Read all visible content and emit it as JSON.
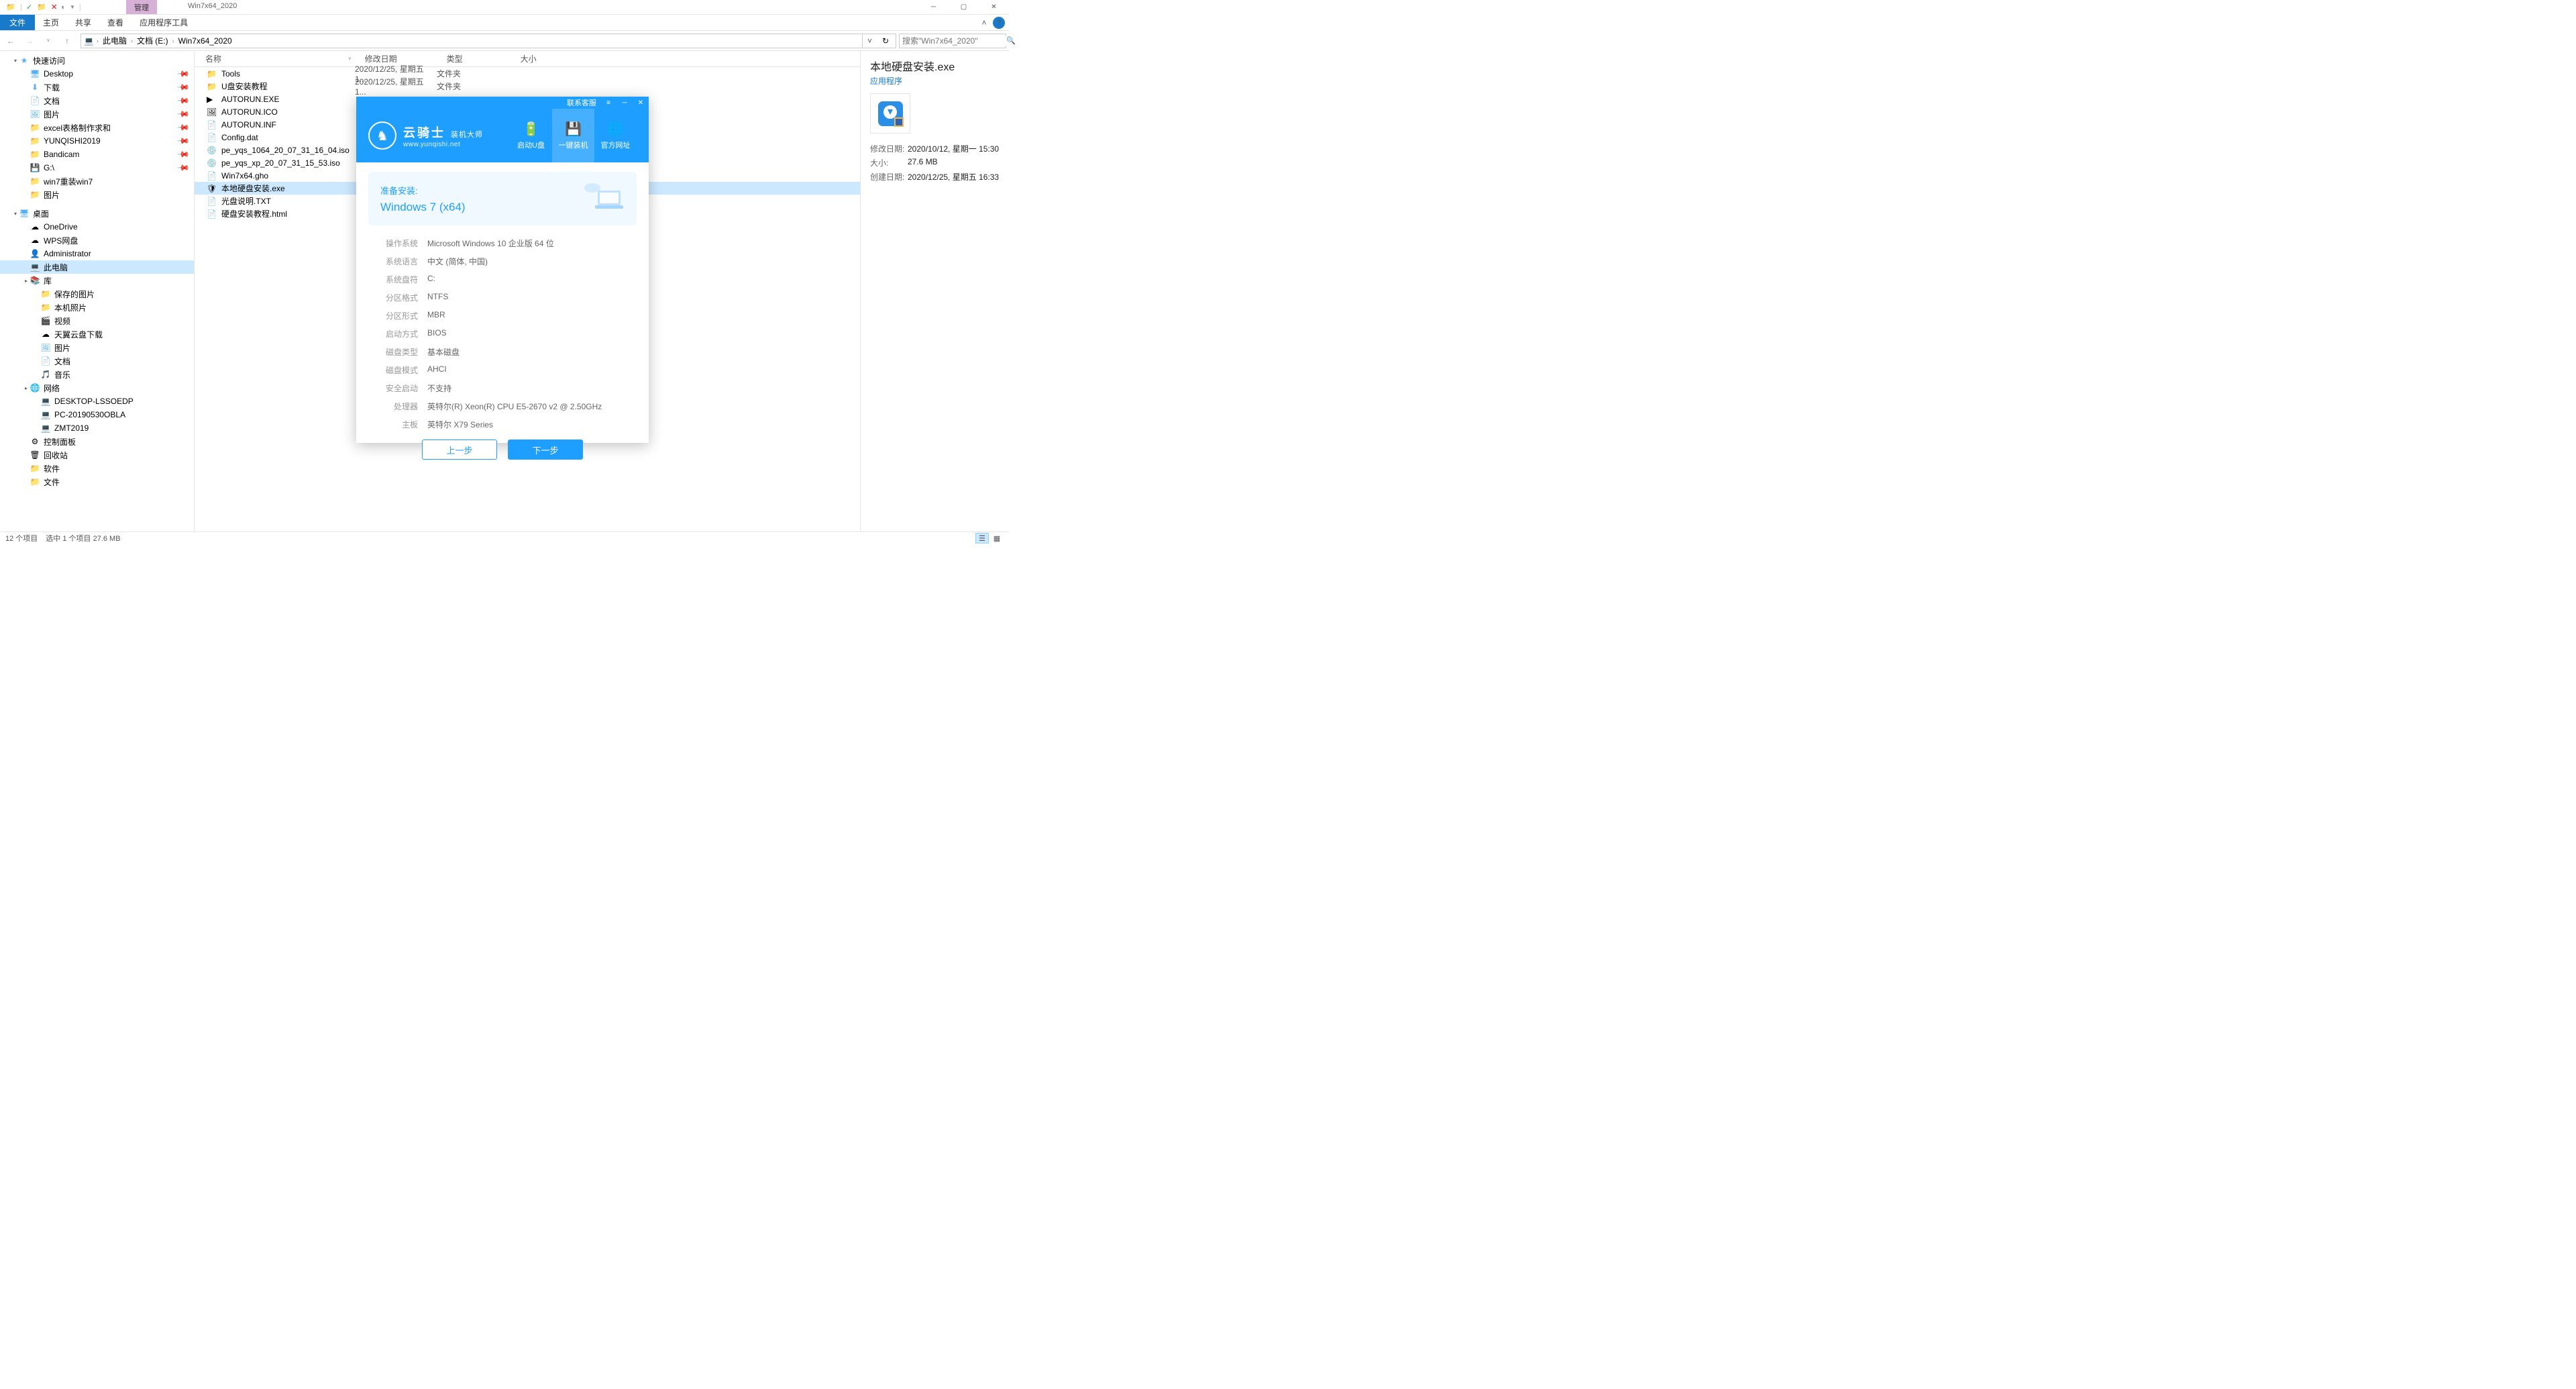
{
  "title_bar": {
    "context_tab": "管理",
    "window_title": "Win7x64_2020"
  },
  "ribbon": {
    "file": "文件",
    "home": "主页",
    "share": "共享",
    "view": "查看",
    "apptools": "应用程序工具"
  },
  "breadcrumb": {
    "root": "此电脑",
    "drive": "文档 (E:)",
    "folder": "Win7x64_2020"
  },
  "search": {
    "placeholder": "搜索\"Win7x64_2020\""
  },
  "sidebar_groups": [
    {
      "indent": 18,
      "icon": "star-icon",
      "glyph": "★",
      "label": "快速访问",
      "exp": "▾"
    },
    {
      "indent": 34,
      "icon": "desktop-icon",
      "glyph": "🖥",
      "label": "Desktop",
      "pin": true
    },
    {
      "indent": 34,
      "icon": "download-icon",
      "glyph": "⬇",
      "label": "下载",
      "pin": true
    },
    {
      "indent": 34,
      "icon": "doc-icon",
      "glyph": "📄",
      "label": "文档",
      "pin": true
    },
    {
      "indent": 34,
      "icon": "pic-icon",
      "glyph": "🖼",
      "label": "图片",
      "pin": true
    },
    {
      "indent": 34,
      "icon": "folder-icon",
      "glyph": "📁",
      "label": "excel表格制作求和",
      "pin": true
    },
    {
      "indent": 34,
      "icon": "folder-icon",
      "glyph": "📁",
      "label": "YUNQISHI2019",
      "pin": true
    },
    {
      "indent": 34,
      "icon": "folder-icon",
      "glyph": "📁",
      "label": "Bandicam",
      "pin": true
    },
    {
      "indent": 34,
      "icon": "drive-icon",
      "glyph": "💾",
      "label": "G:\\",
      "pin": true
    },
    {
      "indent": 34,
      "icon": "folder-icon",
      "glyph": "📁",
      "label": "win7重装win7"
    },
    {
      "indent": 34,
      "icon": "folder-icon",
      "glyph": "📁",
      "label": "图片"
    },
    {
      "sep": true
    },
    {
      "indent": 18,
      "icon": "desktop-icon",
      "glyph": "🖥",
      "label": "桌面",
      "exp": "▾"
    },
    {
      "indent": 34,
      "icon": "",
      "glyph": "☁",
      "label": "OneDrive"
    },
    {
      "indent": 34,
      "icon": "",
      "glyph": "☁",
      "label": "WPS网盘"
    },
    {
      "indent": 34,
      "icon": "",
      "glyph": "👤",
      "label": "Administrator"
    },
    {
      "indent": 34,
      "icon": "pc-icon",
      "glyph": "💻",
      "label": "此电脑",
      "selected": true
    },
    {
      "indent": 34,
      "icon": "",
      "glyph": "📚",
      "label": "库",
      "exp": "▸"
    },
    {
      "indent": 50,
      "icon": "folder-icon",
      "glyph": "📁",
      "label": "保存的图片"
    },
    {
      "indent": 50,
      "icon": "folder-icon",
      "glyph": "📁",
      "label": "本机照片"
    },
    {
      "indent": 50,
      "icon": "",
      "glyph": "🎬",
      "label": "视频"
    },
    {
      "indent": 50,
      "icon": "",
      "glyph": "☁",
      "label": "天翼云盘下载"
    },
    {
      "indent": 50,
      "icon": "pic-icon",
      "glyph": "🖼",
      "label": "图片"
    },
    {
      "indent": 50,
      "icon": "doc-icon",
      "glyph": "📄",
      "label": "文档"
    },
    {
      "indent": 50,
      "icon": "",
      "glyph": "🎵",
      "label": "音乐"
    },
    {
      "indent": 34,
      "icon": "",
      "glyph": "🌐",
      "label": "网络",
      "exp": "▸"
    },
    {
      "indent": 50,
      "icon": "pc-icon",
      "glyph": "💻",
      "label": "DESKTOP-LSSOEDP"
    },
    {
      "indent": 50,
      "icon": "pc-icon",
      "glyph": "💻",
      "label": "PC-20190530OBLA"
    },
    {
      "indent": 50,
      "icon": "pc-icon",
      "glyph": "💻",
      "label": "ZMT2019"
    },
    {
      "indent": 34,
      "icon": "",
      "glyph": "⚙",
      "label": "控制面板"
    },
    {
      "indent": 34,
      "icon": "",
      "glyph": "🗑",
      "label": "回收站"
    },
    {
      "indent": 34,
      "icon": "folder-icon",
      "glyph": "📁",
      "label": "软件"
    },
    {
      "indent": 34,
      "icon": "folder-icon",
      "glyph": "📁",
      "label": "文件"
    }
  ],
  "file_headers": {
    "name": "名称",
    "date": "修改日期",
    "type": "类型",
    "size": "大小"
  },
  "files": [
    {
      "glyph": "📁",
      "cls": "folder-icon",
      "name": "Tools",
      "date": "2020/12/25, 星期五 1...",
      "type": "文件夹"
    },
    {
      "glyph": "📁",
      "cls": "folder-icon",
      "name": "U盘安装教程",
      "date": "2020/12/25, 星期五 1...",
      "type": "文件夹"
    },
    {
      "glyph": "▶",
      "cls": "",
      "name": "AUTORUN.EXE",
      "date": "",
      "type": ""
    },
    {
      "glyph": "🖼",
      "cls": "",
      "name": "AUTORUN.ICO",
      "date": "",
      "type": ""
    },
    {
      "glyph": "📄",
      "cls": "",
      "name": "AUTORUN.INF",
      "date": "",
      "type": ""
    },
    {
      "glyph": "📄",
      "cls": "",
      "name": "Config.dat",
      "date": "",
      "type": ""
    },
    {
      "glyph": "💿",
      "cls": "",
      "name": "pe_yqs_1064_20_07_31_16_04.iso",
      "date": "",
      "type": ""
    },
    {
      "glyph": "💿",
      "cls": "",
      "name": "pe_yqs_xp_20_07_31_15_53.iso",
      "date": "",
      "type": ""
    },
    {
      "glyph": "📄",
      "cls": "",
      "name": "Win7x64.gho",
      "date": "",
      "type": ""
    },
    {
      "glyph": "🛡",
      "cls": "",
      "name": "本地硬盘安装.exe",
      "date": "",
      "type": "",
      "selected": true
    },
    {
      "glyph": "📄",
      "cls": "",
      "name": "光盘说明.TXT",
      "date": "",
      "type": ""
    },
    {
      "glyph": "📄",
      "cls": "",
      "name": "硬盘安装教程.html",
      "date": "",
      "type": ""
    }
  ],
  "details": {
    "title": "本地硬盘安装.exe",
    "type": "应用程序",
    "props": [
      {
        "k": "修改日期:",
        "v": "2020/10/12, 星期一 15:30"
      },
      {
        "k": "大小:",
        "v": "27.6 MB"
      },
      {
        "k": "创建日期:",
        "v": "2020/12/25, 星期五 16:33"
      }
    ]
  },
  "status": {
    "count": "12 个项目",
    "selected": "选中 1 个项目  27.6 MB"
  },
  "dialog": {
    "service": "联系客服",
    "brand_cn": "云骑士",
    "brand_sub": "装机大师",
    "brand_url": "www.yunqishi.net",
    "nav": [
      {
        "icon": "🔋",
        "label": "启动U盘"
      },
      {
        "icon": "💾",
        "label": "一键装机",
        "active": true
      },
      {
        "icon": "🌐",
        "label": "官方网址"
      }
    ],
    "prepare": "准备安装:",
    "os": "Windows 7 (x64)",
    "info": [
      {
        "k": "操作系统",
        "v": "Microsoft Windows 10 企业版 64 位"
      },
      {
        "k": "系统语言",
        "v": "中文 (简体, 中国)"
      },
      {
        "k": "系统盘符",
        "v": "C:"
      },
      {
        "k": "分区格式",
        "v": "NTFS"
      },
      {
        "k": "分区形式",
        "v": "MBR"
      },
      {
        "k": "启动方式",
        "v": "BIOS"
      },
      {
        "k": "磁盘类型",
        "v": "基本磁盘"
      },
      {
        "k": "磁盘模式",
        "v": "AHCI"
      },
      {
        "k": "安全启动",
        "v": "不支持"
      },
      {
        "k": "处理器",
        "v": "英特尔(R) Xeon(R) CPU E5-2670 v2 @ 2.50GHz"
      },
      {
        "k": "主板",
        "v": "英特尔 X79 Series"
      }
    ],
    "btn_prev": "上一步",
    "btn_next": "下一步"
  }
}
